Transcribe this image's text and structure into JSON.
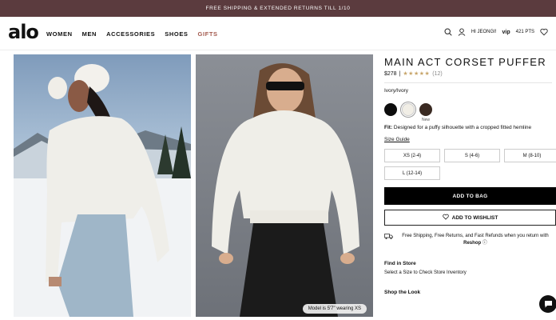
{
  "promo": "FREE SHIPPING & EXTENDED RETURNS TILL 1/10",
  "header": {
    "logo": "alo",
    "nav": [
      "WOMEN",
      "MEN",
      "ACCESSORIES",
      "SHOES",
      "GIFTS"
    ],
    "greeting": "HI JEONGI!",
    "vip_label": "vip",
    "points": "421 PTS"
  },
  "gallery": {
    "model_info": "Model is 5'7\" wearing XS"
  },
  "product": {
    "title": "MAIN ACT CORSET PUFFER",
    "price": "$278",
    "rating_stars": "★★★★★",
    "review_count": "(12)",
    "color_name": "Ivory/Ivory",
    "swatches": [
      {
        "color": "#0d0d0d",
        "label": ""
      },
      {
        "color": "#f1eee6",
        "label": ""
      },
      {
        "color": "#3a2a22",
        "label": "New"
      }
    ],
    "fit_label": "Fit:",
    "fit_text": "Designed for a puffy silhouette with a cropped fitted hemline",
    "size_guide": "Size Guide",
    "sizes": [
      "XS (2-4)",
      "S (4-6)",
      "M (8-10)",
      "L (12-14)"
    ],
    "add_to_bag": "ADD TO BAG",
    "add_to_wishlist": "ADD TO WISHLIST",
    "shipping_text": "Free Shipping, Free Returns, and Fast Refunds when you return with",
    "reshop": "Reshop",
    "find_in_store": "Find in Store",
    "find_in_store_sub": "Select a Size to Check Store Inventory",
    "shop_the_look": "Shop the Look"
  },
  "colors": {
    "promo_bg": "#5b3b3e",
    "gifts_accent": "#a35a4e",
    "star": "#c8a66b"
  }
}
